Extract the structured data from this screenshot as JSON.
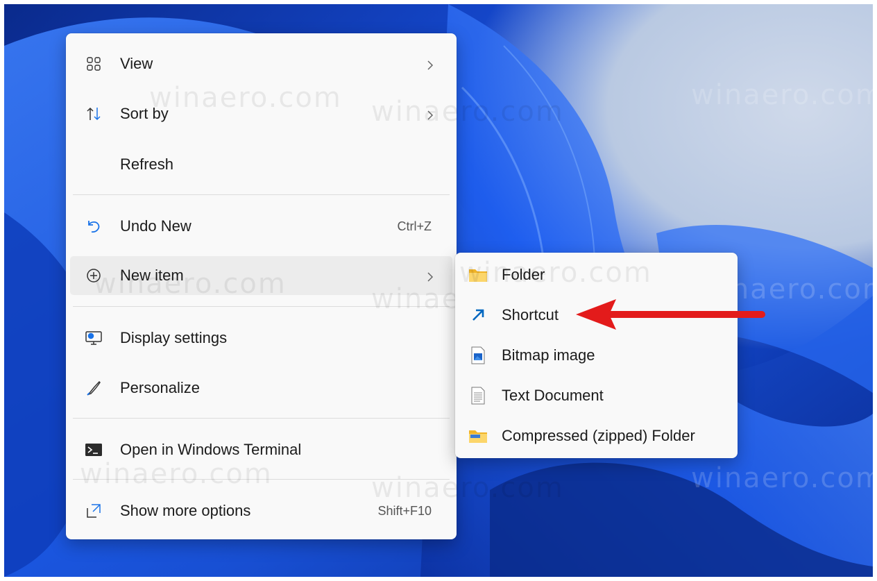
{
  "main_menu": {
    "items": [
      {
        "label": "View",
        "icon": "grid-view-icon",
        "submenu": true
      },
      {
        "label": "Sort by",
        "icon": "sort-arrows-icon",
        "submenu": true
      },
      {
        "label": "Refresh",
        "icon": ""
      },
      {
        "label": "Undo New",
        "icon": "undo-icon",
        "shortcut": "Ctrl+Z"
      },
      {
        "label": "New item",
        "icon": "plus-circle-icon",
        "submenu": true,
        "hovered": true
      },
      {
        "label": "Display settings",
        "icon": "display-settings-icon"
      },
      {
        "label": "Personalize",
        "icon": "brush-icon"
      },
      {
        "label": "Open in Windows Terminal",
        "icon": "terminal-icon"
      },
      {
        "label": "Show more options",
        "icon": "expand-icon",
        "shortcut": "Shift+F10"
      }
    ]
  },
  "new_submenu": {
    "items": [
      {
        "label": "Folder",
        "icon": "folder-icon"
      },
      {
        "label": "Shortcut",
        "icon": "shortcut-arrow-icon",
        "highlighted_by_arrow": true
      },
      {
        "label": "Bitmap image",
        "icon": "bitmap-icon"
      },
      {
        "label": "Text Document",
        "icon": "text-document-icon"
      },
      {
        "label": "Compressed (zipped) Folder",
        "icon": "zip-folder-icon"
      }
    ]
  },
  "watermark": "winaero.com",
  "colors": {
    "arrow": "#e31b1b",
    "accent": "#0067c0",
    "folder": "#f4c246"
  }
}
